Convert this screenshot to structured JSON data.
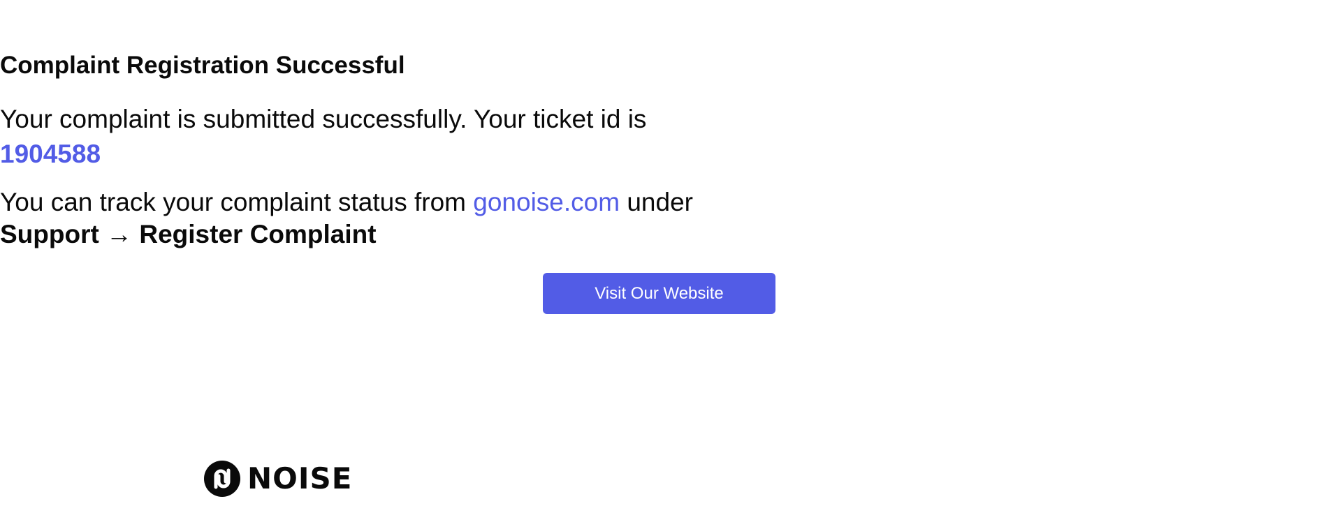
{
  "header": {
    "title": "Complaint Registration Successful"
  },
  "message": {
    "submitted_text": "Your complaint is submitted successfully. Your ticket id is",
    "ticket_id": "1904588"
  },
  "tracking": {
    "prefix": "You can track your complaint status from",
    "link_text": "gonoise.com",
    "suffix": "under",
    "path_text": "Support → Register Complaint"
  },
  "cta": {
    "button_label": "Visit Our Website"
  },
  "footer": {
    "logo_text": "NOISE",
    "logo_icon": "noise-logo-icon"
  },
  "colors": {
    "accent": "#525ce6",
    "text": "#0a0a0a",
    "background": "#ffffff"
  }
}
